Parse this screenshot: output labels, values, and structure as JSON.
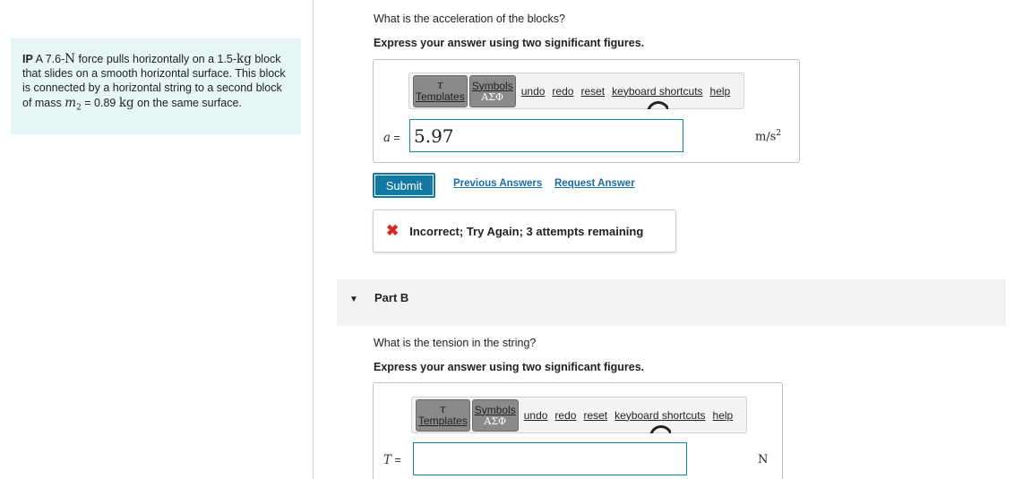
{
  "problem": {
    "prefix": "IP",
    "pre_force": " A 7.6-",
    "force_unit": "N",
    "after_force": " force pulls horizontally on a 1.5-",
    "mass1_unit": "kg",
    "line_rest": " block that slides on a smooth horizontal surface. This block is connected by a horizontal string to a second block of mass ",
    "m2_symbol": "m",
    "m2_sub": "2",
    "m2_eq": " = 0.89 ",
    "m2_unit": "kg",
    "tail": " on the same surface."
  },
  "part_a": {
    "question": "What is the acceleration of the blocks?",
    "instruction": "Express your answer using two significant figures.",
    "toolbar": {
      "templates_glyph": "τ",
      "templates_label": "Templates",
      "symbols_label": "Symbols",
      "symbols_sub": "AΣΦ",
      "undo": "undo",
      "redo": "redo",
      "reset": "reset",
      "shortcuts": "keyboard shortcuts",
      "help": "help"
    },
    "var_symbol": "a",
    "var_eq": " =",
    "input_value": "5.97",
    "unit_base": "m/s",
    "unit_exp": "2",
    "submit_label": "Submit",
    "previous_answers": "Previous Answers",
    "request_answer": "Request Answer",
    "feedback_icon": "✖",
    "feedback_text": "Incorrect; Try Again; 3 attempts remaining"
  },
  "part_b": {
    "arrow": "▼",
    "title": "Part B",
    "question": "What is the tension in the string?",
    "instruction": "Express your answer using two significant figures.",
    "toolbar": {
      "templates_glyph": "τ",
      "templates_label": "Templates",
      "symbols_label": "Symbols",
      "symbols_sub": "AΣΦ",
      "undo": "undo",
      "redo": "redo",
      "reset": "reset",
      "shortcuts": "keyboard shortcuts",
      "help": "help"
    },
    "var_symbol": "T",
    "var_eq": " =",
    "input_value": "",
    "unit": "N"
  },
  "colors": {
    "problem_bg": "#e6f6f7",
    "submit_bg": "#1379a3",
    "link": "#1a6ea8",
    "incorrect": "#d42a1f",
    "input_border": "#1583a8"
  }
}
